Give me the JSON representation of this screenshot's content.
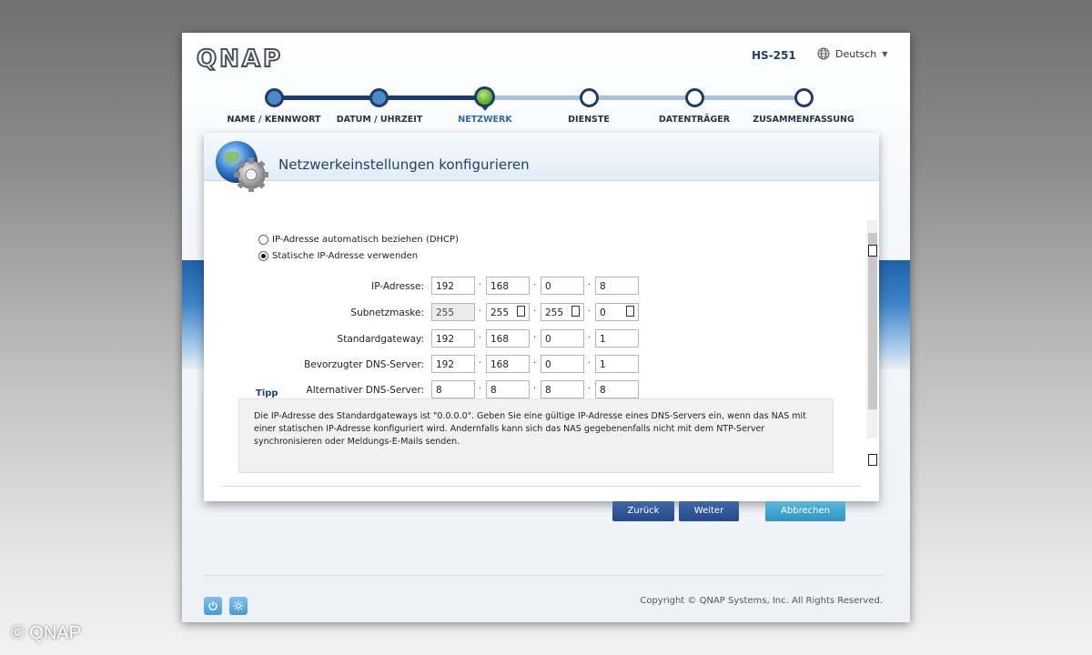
{
  "photo_credit": "© QNAP",
  "header": {
    "logo": "QNAP",
    "model": "HS-251",
    "language": "Deutsch"
  },
  "steps": [
    {
      "label": "NAME / KENNWORT",
      "state": "done"
    },
    {
      "label": "DATUM / UHRZEIT",
      "state": "done"
    },
    {
      "label": "NETZWERK",
      "state": "active"
    },
    {
      "label": "DIENSTE",
      "state": "todo"
    },
    {
      "label": "DATENTRÄGER",
      "state": "todo"
    },
    {
      "label": "ZUSAMMENFASSUNG",
      "state": "todo"
    }
  ],
  "dialog": {
    "title": "Netzwerkeinstellungen konfigurieren",
    "radio_dhcp": "IP-Adresse automatisch beziehen (DHCP)",
    "radio_static": "Statische IP-Adresse verwenden",
    "selected_mode": "static",
    "fields": {
      "ip": {
        "label": "IP-Adresse:",
        "octets": [
          "192",
          "168",
          "0",
          "8"
        ]
      },
      "subnet": {
        "label": "Subnetzmaske:",
        "octets": [
          "255",
          "255",
          "255",
          "0"
        ]
      },
      "gateway": {
        "label": "Standardgateway:",
        "octets": [
          "192",
          "168",
          "0",
          "1"
        ]
      },
      "dns1": {
        "label": "Bevorzugter DNS-Server:",
        "octets": [
          "192",
          "168",
          "0",
          "1"
        ]
      },
      "dns2": {
        "label": "Alternativer DNS-Server:",
        "octets": [
          "8",
          "8",
          "8",
          "8"
        ]
      }
    },
    "separator": "·",
    "tip_title": "Tipp",
    "tip_text": "Die IP-Adresse des Standardgateways ist \"0.0.0.0\". Geben Sie eine gültige IP-Adresse eines DNS-Servers ein, wenn das NAS mit einer statischen IP-Adresse konfiguriert wird. Andernfalls kann sich das NAS gegebenenfalls nicht mit dem NTP-Server synchronisieren oder Meldungs-E-Mails senden.",
    "buttons": {
      "back": "Zurück",
      "next": "Weiter",
      "cancel": "Abbrechen"
    }
  },
  "footer": {
    "copyright": "Copyright © QNAP Systems, Inc. All Rights Reserved."
  },
  "colors": {
    "primary": "#24498a",
    "accent": "#2f95c4",
    "active_step": "#65b033",
    "track_done": "#1c3d6b",
    "track_todo": "#a8c3e2"
  }
}
